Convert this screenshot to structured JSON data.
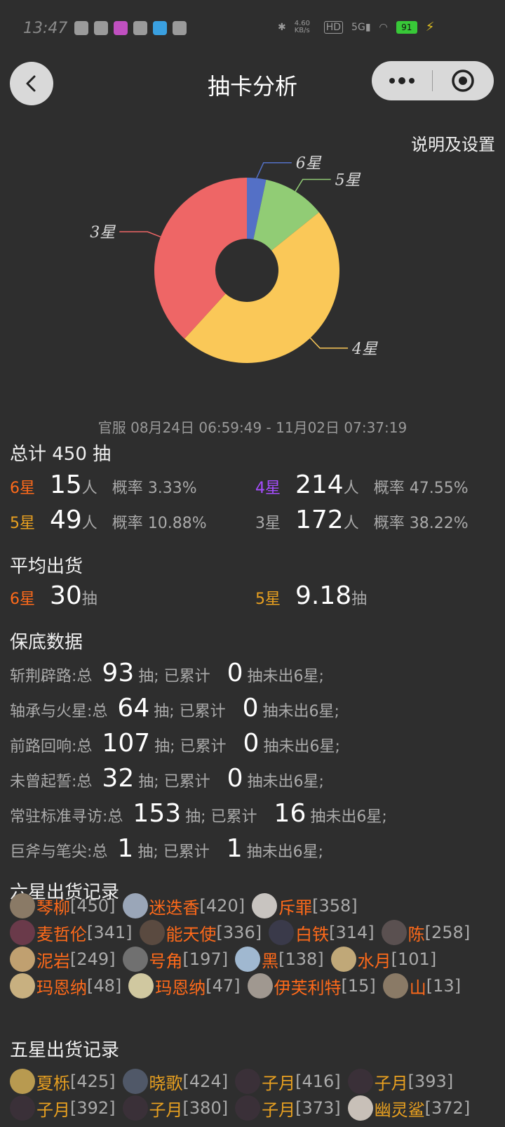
{
  "status": {
    "time": "13:47",
    "speed": "4.60 KB/s",
    "network": "5G",
    "hd": "HD",
    "battery": "91"
  },
  "nav": {
    "title": "抽卡分析",
    "back_icon": "chevron-left-icon",
    "more_icon": "more-dots-icon",
    "target_icon": "target-icon"
  },
  "settings_label": "说明及设置",
  "chart_data": {
    "type": "pie",
    "donut": true,
    "categories": [
      "6星",
      "5星",
      "4星",
      "3星"
    ],
    "values": [
      15,
      49,
      214,
      172
    ],
    "colors": [
      "#5470c6",
      "#91cc75",
      "#fac858",
      "#ee6666"
    ]
  },
  "date_range": "官服  08月24日 06:59:49  -  11月02日 07:37:19",
  "summary": {
    "total_label": "总计 450 抽",
    "rows": [
      {
        "star": "6星",
        "count": "15",
        "unit": "人",
        "rate_label": "概率",
        "rate": "3.33%"
      },
      {
        "star": "4星",
        "count": "214",
        "unit": "人",
        "rate_label": "概率",
        "rate": "47.55%"
      },
      {
        "star": "5星",
        "count": "49",
        "unit": "人",
        "rate_label": "概率",
        "rate": "10.88%"
      },
      {
        "star": "3星",
        "count": "172",
        "unit": "人",
        "rate_label": "概率",
        "rate": "38.22%"
      }
    ]
  },
  "average": {
    "title": "平均出货",
    "six": {
      "star": "6星",
      "value": "30",
      "unit": "抽"
    },
    "five": {
      "star": "5星",
      "value": "9.18",
      "unit": "抽"
    }
  },
  "pity": {
    "title": "保底数据",
    "rows": [
      {
        "name": "斩荆辟路:总",
        "total": "93",
        "mid": "抽;  已累计",
        "acc": "0",
        "tail": "抽未出6星;"
      },
      {
        "name": "轴承与火星:总",
        "total": "64",
        "mid": "抽;  已累计",
        "acc": "0",
        "tail": "抽未出6星;"
      },
      {
        "name": "前路回响:总",
        "total": "107",
        "mid": "抽;  已累计",
        "acc": "0",
        "tail": "抽未出6星;"
      },
      {
        "name": "未曾起誓:总",
        "total": "32",
        "mid": "抽;  已累计",
        "acc": "0",
        "tail": "抽未出6星;"
      },
      {
        "name": "常驻标准寻访:总",
        "total": "153",
        "mid": "抽;  已累计",
        "acc": "16",
        "tail": "抽未出6星;"
      },
      {
        "name": "巨斧与笔尖:总",
        "total": "1",
        "mid": "抽;  已累计",
        "acc": "1",
        "tail": "抽未出6星;"
      }
    ]
  },
  "six_records": {
    "title": "六星出货记录",
    "lines": [
      [
        {
          "name": "琴柳",
          "count": "[450]"
        },
        {
          "name": "迷迭香",
          "count": "[420]"
        },
        {
          "name": "斥罪",
          "count": "[358]"
        }
      ],
      [
        {
          "name": "麦哲伦",
          "count": "[341]"
        },
        {
          "name": "能天使",
          "count": "[336]"
        },
        {
          "name": "白铁",
          "count": "[314]"
        },
        {
          "name": "陈",
          "count": "[258]"
        }
      ],
      [
        {
          "name": "泥岩",
          "count": "[249]"
        },
        {
          "name": "号角",
          "count": "[197]"
        },
        {
          "name": "黑",
          "count": "[138]"
        },
        {
          "name": "水月",
          "count": "[101]"
        }
      ],
      [
        {
          "name": "玛恩纳",
          "count": "[48]"
        },
        {
          "name": "玛恩纳",
          "count": "[47]"
        },
        {
          "name": "伊芙利特",
          "count": "[15]"
        },
        {
          "name": "山",
          "count": "[13]"
        }
      ]
    ]
  },
  "five_records": {
    "title": "五星出货记录",
    "lines": [
      [
        {
          "name": "夏栎",
          "count": "[425]"
        },
        {
          "name": "晓歌",
          "count": "[424]"
        },
        {
          "name": "子月",
          "count": "[416]"
        },
        {
          "name": "子月",
          "count": "[393]"
        }
      ],
      [
        {
          "name": "子月",
          "count": "[392]"
        },
        {
          "name": "子月",
          "count": "[380]"
        },
        {
          "name": "子月",
          "count": "[373]"
        },
        {
          "name": "幽灵鲨",
          "count": "[372]"
        }
      ]
    ]
  }
}
